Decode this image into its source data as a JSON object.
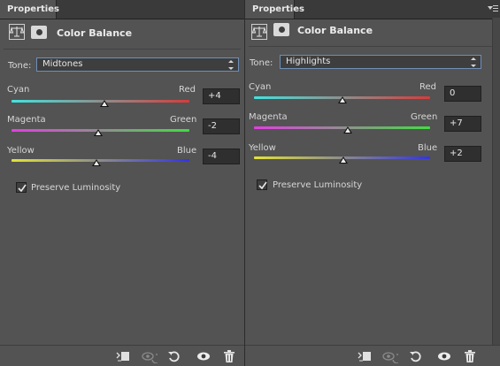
{
  "panels": [
    {
      "tab_label": "Properties",
      "title": "Color Balance",
      "adjustment_icon": "scales-icon",
      "mask_icon": "layer-mask-icon",
      "tone": {
        "label": "Tone:",
        "value": "Midtones"
      },
      "sliders": [
        {
          "left_label": "Cyan",
          "right_label": "Red",
          "value": "+4",
          "level": 4,
          "range": [
            -100,
            100
          ]
        },
        {
          "left_label": "Magenta",
          "right_label": "Green",
          "value": "-2",
          "level": -2,
          "range": [
            -100,
            100
          ]
        },
        {
          "left_label": "Yellow",
          "right_label": "Blue",
          "value": "-4",
          "level": -4,
          "range": [
            -100,
            100
          ]
        }
      ],
      "preserve_luminosity": {
        "label": "Preserve Luminosity",
        "checked": true
      },
      "footer_icons": [
        "clip-to-layer-icon",
        "view-previous-state-icon",
        "reset-icon",
        "visibility-eye-icon",
        "delete-trash-icon"
      ]
    },
    {
      "tab_label": "Properties",
      "title": "Color Balance",
      "adjustment_icon": "scales-icon",
      "mask_icon": "layer-mask-icon",
      "tone": {
        "label": "Tone:",
        "value": "Highlights"
      },
      "sliders": [
        {
          "left_label": "Cyan",
          "right_label": "Red",
          "value": "0",
          "level": 0,
          "range": [
            -100,
            100
          ]
        },
        {
          "left_label": "Magenta",
          "right_label": "Green",
          "value": "+7",
          "level": 7,
          "range": [
            -100,
            100
          ]
        },
        {
          "left_label": "Yellow",
          "right_label": "Blue",
          "value": "+2",
          "level": 2,
          "range": [
            -100,
            100
          ]
        }
      ],
      "preserve_luminosity": {
        "label": "Preserve Luminosity",
        "checked": true
      },
      "footer_icons": [
        "clip-to-layer-icon",
        "view-previous-state-icon",
        "reset-icon",
        "visibility-eye-icon",
        "delete-trash-icon"
      ]
    }
  ],
  "colors": {
    "panel_bg": "#535353",
    "field_bg": "#2f2f2f",
    "select_focus_border": "#6f8fb8",
    "cyan": "#41e4e0",
    "red": "#d83b3b",
    "magenta": "#e33ee3",
    "green": "#41dd41",
    "yellow": "#e3e336",
    "blue": "#3434e3"
  }
}
